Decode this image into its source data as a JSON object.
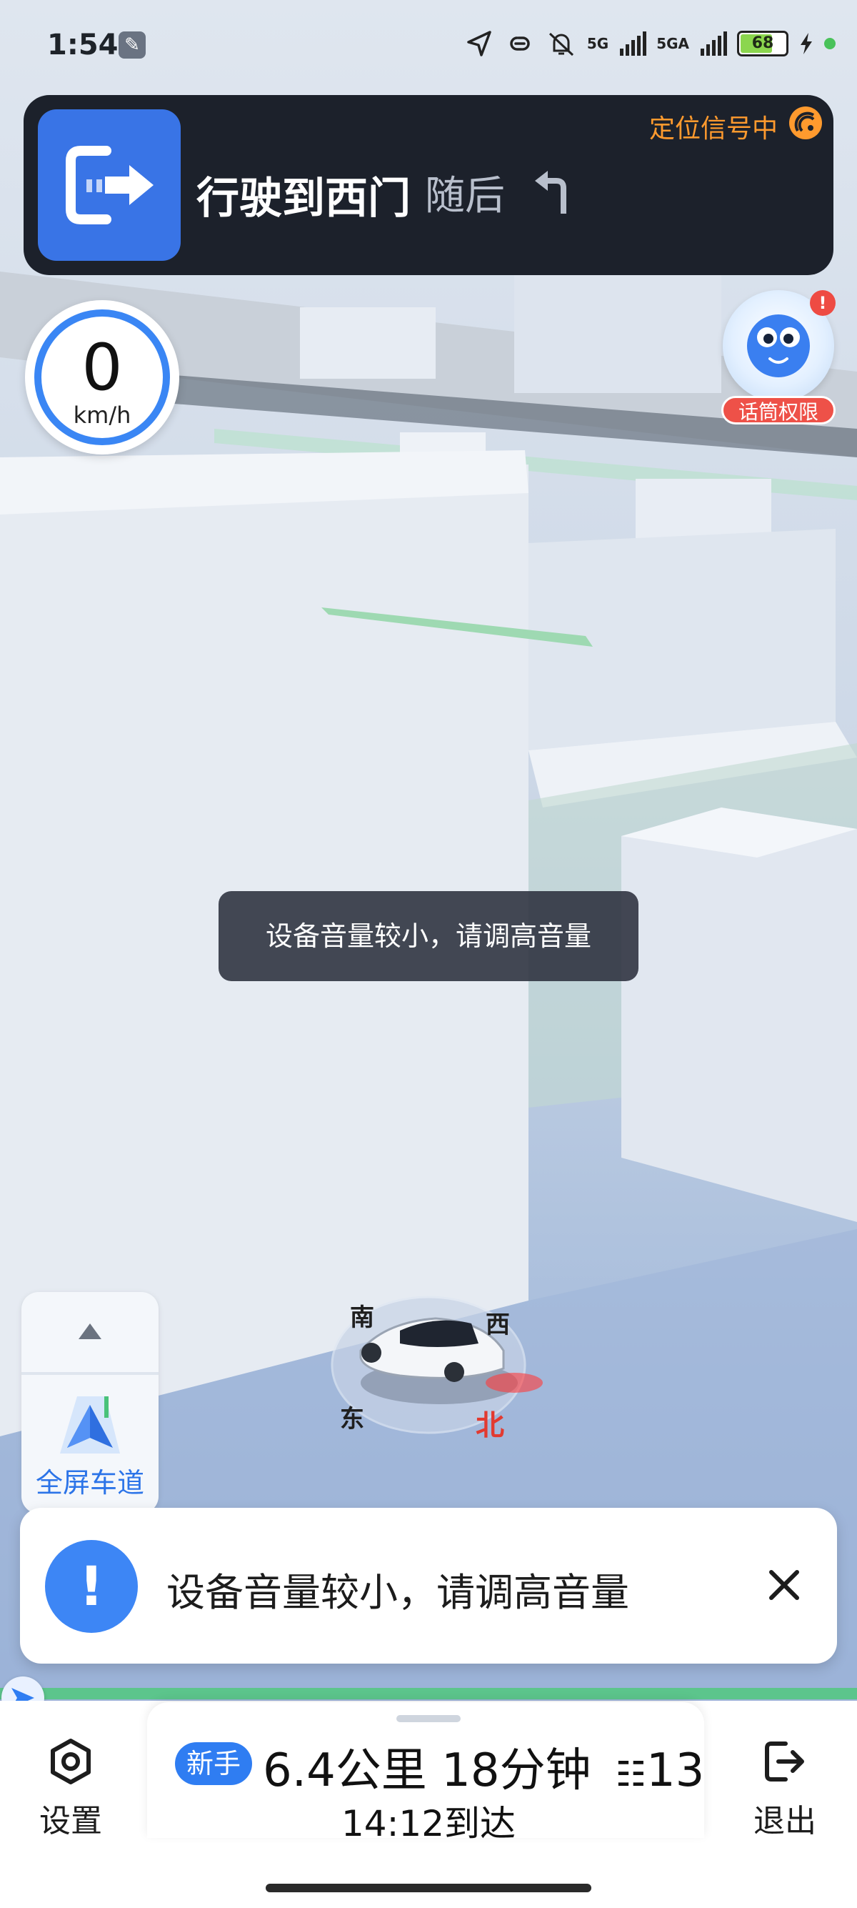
{
  "status_bar": {
    "time": "1:54",
    "network_1": "5G",
    "network_2": "5GA",
    "battery": "68"
  },
  "navigation": {
    "instruction": "行驶到西门",
    "then_label": "随后",
    "gps_status": "定位信号中"
  },
  "speed": {
    "value": "0",
    "unit": "km/h"
  },
  "assistant": {
    "badge": "!",
    "label": "话筒权限"
  },
  "toast": {
    "message": "设备音量较小，请调高音量"
  },
  "lane_panel": {
    "label": "全屏车道"
  },
  "compass": {
    "south": "南",
    "west": "西",
    "east": "东",
    "north": "北"
  },
  "notification": {
    "icon": "!",
    "message": "设备音量较小，请调高音量"
  },
  "bottom_bar": {
    "settings_label": "设置",
    "exit_label": "退出",
    "novice_badge": "新手",
    "distance": "6.4公里",
    "duration": "18分钟",
    "traffic_lights": "13",
    "eta": "14:12到达"
  },
  "colors": {
    "nav_card_bg": "#1c212b",
    "nav_icon_blue": "#3974e6",
    "gps_orange": "#ff9a2e",
    "accent_blue": "#2f7df2",
    "route_green": "#5cc58c",
    "badge_red": "#ee4b43"
  },
  "icons": {
    "settings": "gear-icon",
    "exit": "exit-icon",
    "close": "close-icon",
    "lane": "lane-arrow-icon",
    "turn": "exit-turn-icon",
    "then_turn": "turn-left-icon"
  }
}
